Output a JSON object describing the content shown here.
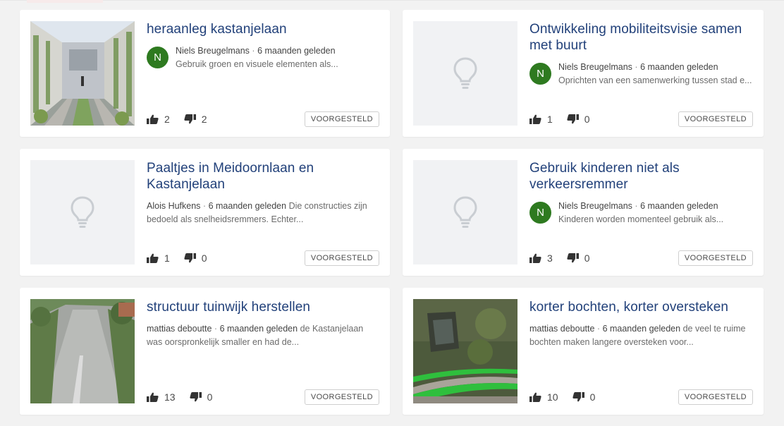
{
  "ideas": [
    {
      "title": "heraanleg kastanjelaan",
      "author": "Niels Breugelmans",
      "ago": "6 maanden geleden",
      "avatar_letter": "N",
      "description": "Gebruik groen en visuele elementen als...",
      "likes": "2",
      "dislikes": "2",
      "status": "VOORGESTELD",
      "image": "street-rendering"
    },
    {
      "title": "Ontwikkeling mobiliteitsvisie samen met buurt",
      "author": "Niels Breugelmans",
      "ago": "6 maanden geleden",
      "avatar_letter": "N",
      "description": "Oprichten van een samenwerking tussen stad e...",
      "likes": "1",
      "dislikes": "0",
      "status": "VOORGESTELD",
      "image": "lightbulb-placeholder"
    },
    {
      "title": "Paaltjes in Meidoornlaan en Kastanjelaan",
      "author": "Alois Hufkens",
      "ago": "6 maanden geleden",
      "description": "Die constructies zijn bedoeld als snelheidsremmers. Echter...",
      "likes": "1",
      "dislikes": "0",
      "status": "VOORGESTELD",
      "image": "lightbulb-placeholder"
    },
    {
      "title": "Gebruik kinderen niet als verkeersremmer",
      "author": "Niels Breugelmans",
      "ago": "6 maanden geleden",
      "avatar_letter": "N",
      "description": "Kinderen worden momenteel gebruik als...",
      "likes": "3",
      "dislikes": "0",
      "status": "VOORGESTELD",
      "image": "lightbulb-placeholder"
    },
    {
      "title": "structuur tuinwijk herstellen",
      "author": "mattias deboutte",
      "ago": "6 maanden geleden",
      "description": "de Kastanjelaan was oorspronkelijk smaller en had de...",
      "likes": "13",
      "dislikes": "0",
      "status": "VOORGESTELD",
      "image": "street-photo"
    },
    {
      "title": "korter bochten, korter oversteken",
      "author": "mattias deboutte",
      "ago": "6 maanden geleden",
      "description": "de veel te ruime bochten maken langere oversteken voor...",
      "likes": "10",
      "dislikes": "0",
      "status": "VOORGESTELD",
      "image": "aerial-map"
    }
  ],
  "separator": "·",
  "colors": {
    "title": "#22417a",
    "avatar": "#2e7a20",
    "background": "#f2f2f2",
    "placeholder": "#f1f2f4"
  }
}
